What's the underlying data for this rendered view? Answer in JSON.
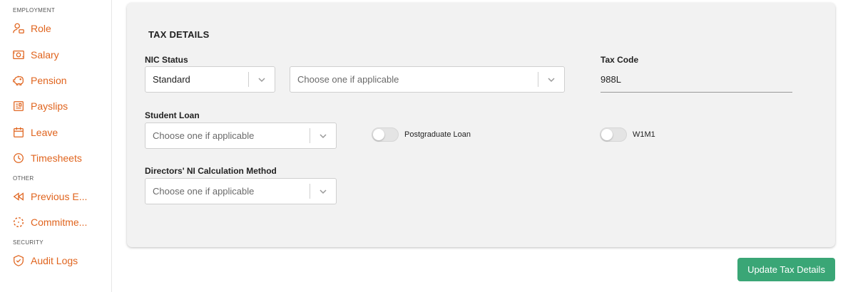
{
  "sidebar": {
    "sections": [
      {
        "label": "EMPLOYMENT"
      },
      {
        "label": "OTHER"
      },
      {
        "label": "SECURITY"
      }
    ],
    "items": [
      {
        "label": "Role",
        "icon": "user-badge-icon"
      },
      {
        "label": "Salary",
        "icon": "banknote-icon"
      },
      {
        "label": "Pension",
        "icon": "piggy-bank-icon"
      },
      {
        "label": "Payslips",
        "icon": "payslip-icon"
      },
      {
        "label": "Leave",
        "icon": "calendar-icon"
      },
      {
        "label": "Timesheets",
        "icon": "clock-icon"
      },
      {
        "label": "Previous E...",
        "icon": "rewind-icon"
      },
      {
        "label": "Commitme...",
        "icon": "dashed-circle-icon"
      },
      {
        "label": "Audit Logs",
        "icon": "shield-check-icon"
      }
    ],
    "accent_color": "#e0641e"
  },
  "card": {
    "title": "TAX DETAILS",
    "nic_status": {
      "label": "NIC Status",
      "value": "Standard"
    },
    "nic_category": {
      "value": "Choose one if applicable"
    },
    "tax_code": {
      "label": "Tax Code",
      "value": "988L"
    },
    "student_loan": {
      "label": "Student Loan",
      "value": "Choose one if applicable"
    },
    "postgraduate_loan": {
      "label": "Postgraduate Loan",
      "on": false
    },
    "w1m1": {
      "label": "W1M1",
      "on": false
    },
    "directors_ni": {
      "label": "Directors' NI Calculation Method",
      "value": "Choose one if applicable"
    }
  },
  "actions": {
    "update_label": "Update Tax Details",
    "button_color": "#3aa676"
  }
}
